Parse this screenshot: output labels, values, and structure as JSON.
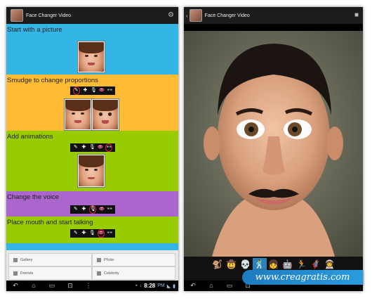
{
  "left_screen": {
    "title": "Face Changer Video",
    "action_icon": "settings-sliders-icon",
    "sections": [
      {
        "title": "Start with a picture",
        "color": "#33b5e5"
      },
      {
        "title": "Smudge to change proportions",
        "color": "#ffbb33"
      },
      {
        "title": "Add animations",
        "color": "#99cc00"
      },
      {
        "title": "Change the voice",
        "color": "#aa66cc"
      },
      {
        "title": "Place mouth and start talking",
        "color": "#99cc00"
      }
    ],
    "tool_icons": [
      "smudge-icon",
      "move-icon",
      "microphone-icon",
      "lips-icon",
      "glasses-icon"
    ],
    "tool_glyphs": [
      "✎",
      "✚",
      "🎙",
      "👄",
      "👓"
    ],
    "grid": {
      "gallery": "Gallery",
      "photo": "Photo",
      "friends": "Friends",
      "celebrity": "Celebrity"
    },
    "clock": "8:28",
    "clock_suffix": "PM"
  },
  "right_screen": {
    "title": "Face Changer Video",
    "action_icon": "video-camera-icon",
    "animation_icons": [
      "monkey-icon",
      "cowboy-icon",
      "skeleton-icon",
      "dancer-icon",
      "girl-icon",
      "robot-icon",
      "runner-icon",
      "hero-icon",
      "astronaut-icon"
    ],
    "animation_glyphs": [
      "🐒",
      "🤠",
      "💀",
      "🕺",
      "👧",
      "🤖",
      "🏃",
      "🦸",
      "👨‍🚀"
    ],
    "active_animation": 3,
    "confirm_glyph": "✓"
  },
  "nav_glyphs": {
    "back": "↶",
    "home": "⌂",
    "recent": "▭",
    "screenshot": "⊡",
    "menu": "⋮"
  },
  "watermark": "www.creagratis.com",
  "colors": {
    "selected_tool_ring": "#ee2233",
    "watermark_blue": "#1e7bbf"
  }
}
